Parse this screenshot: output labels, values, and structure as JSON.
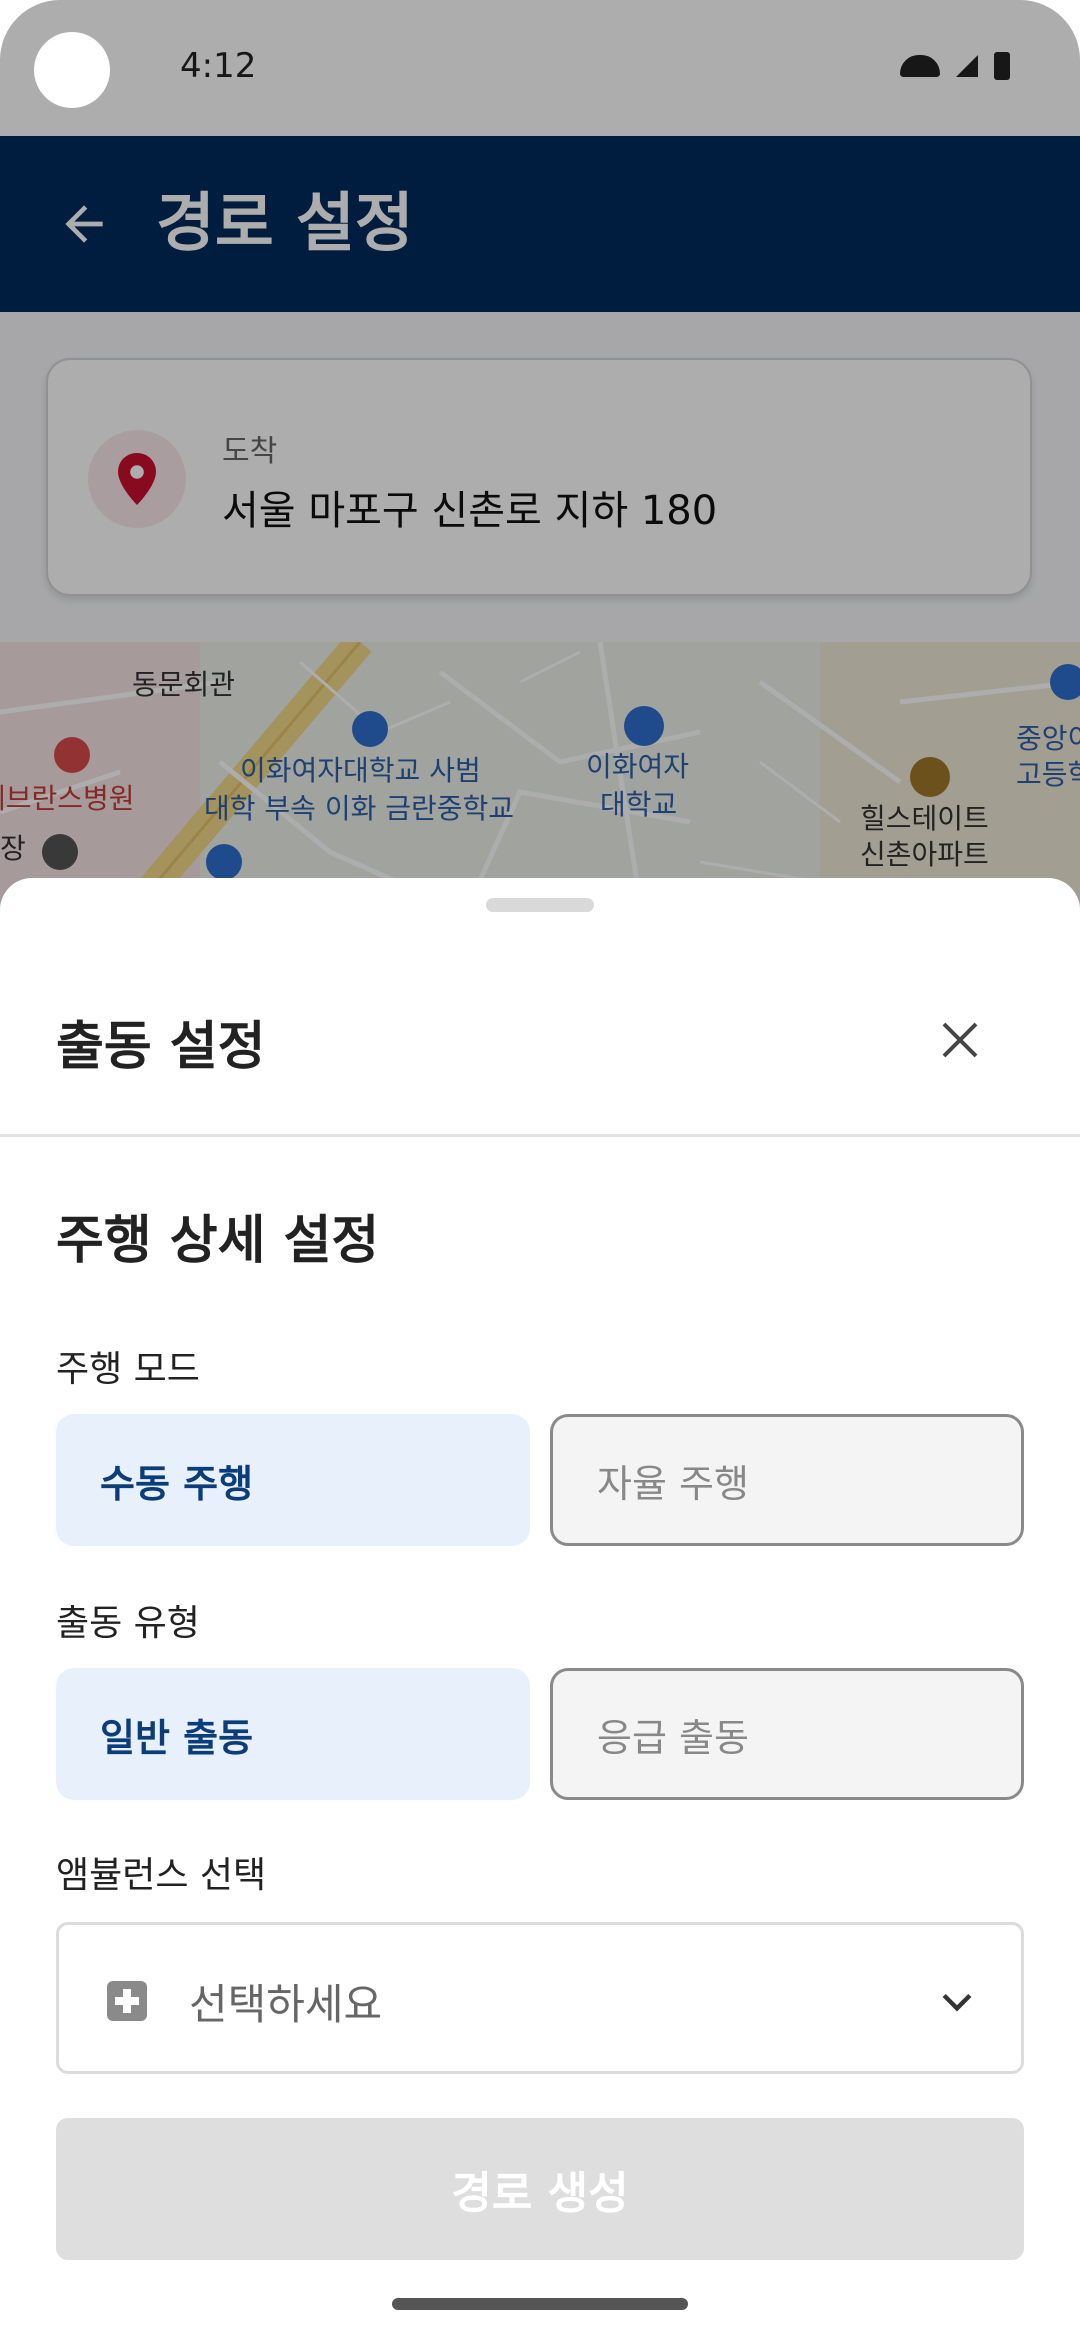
{
  "status_bar": {
    "time": "4:12"
  },
  "app_bar": {
    "title": "경로 설정"
  },
  "destination": {
    "label": "도착",
    "address": "서울 마포구 신촌로 지하 180"
  },
  "map": {
    "labels": [
      "동문회관",
      "세브란스병원",
      "이화여자대학교 사범",
      "대학 부속 이화 금란중학교",
      "이화여자",
      "대학교",
      "힐스테이트",
      "신촌아파트",
      "중앙이",
      "고등학",
      "장"
    ]
  },
  "sheet": {
    "title": "출동 설정",
    "section_title": "주행 상세 설정",
    "drive_mode": {
      "label": "주행 모드",
      "options": [
        "수동 주행",
        "자율 주행"
      ],
      "selected": "수동 주행"
    },
    "dispatch_type": {
      "label": "출동 유형",
      "options": [
        "일반 출동",
        "응급 출동"
      ],
      "selected": "일반 출동"
    },
    "ambulance": {
      "label": "앰뷸런스 선택",
      "placeholder": "선택하세요"
    },
    "route_button": "경로 생성"
  },
  "colors": {
    "app_bar": "#002c5f",
    "selected_bg": "#e8f0fb",
    "selected_text": "#0a3d7a",
    "pin": "#c8102e"
  }
}
